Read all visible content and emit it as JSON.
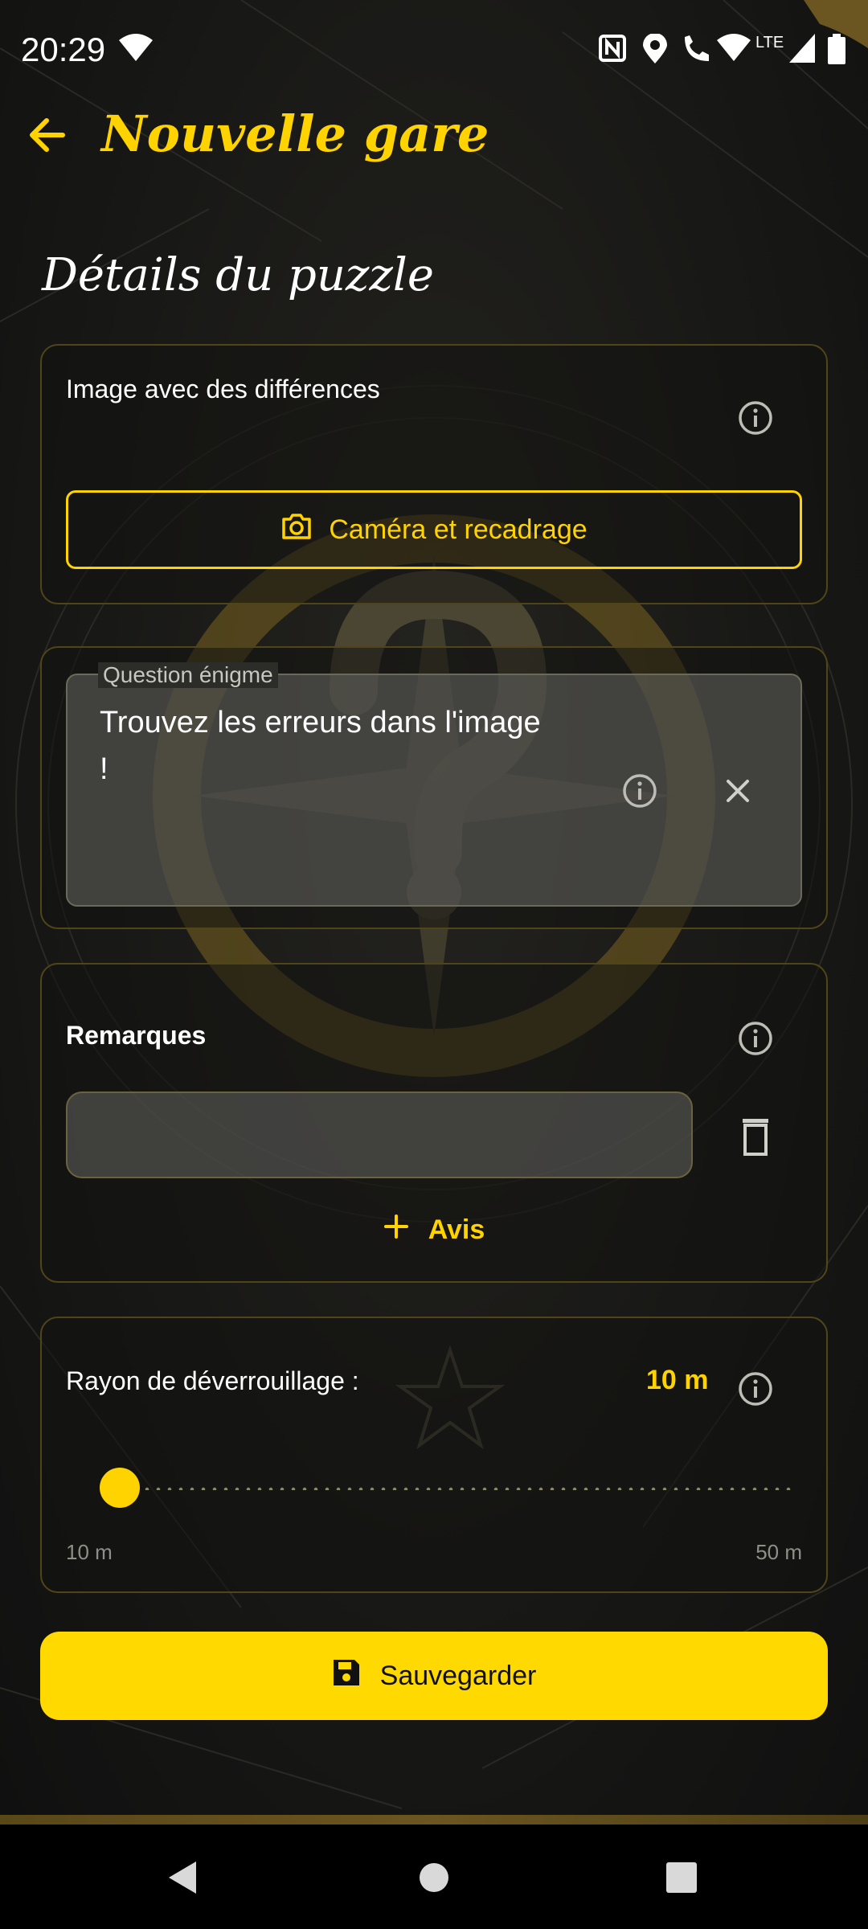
{
  "status_bar": {
    "time": "20:29",
    "network": "LTE",
    "icons": [
      "wifi-icon",
      "nfc-icon",
      "location-icon",
      "wifi-calling-icon",
      "wifi-icon",
      "signal-icon",
      "battery-icon"
    ]
  },
  "app_bar": {
    "title": "Nouvelle gare",
    "back_icon": "arrow-left-icon"
  },
  "section": {
    "title": "Détails du puzzle"
  },
  "image_card": {
    "label": "Image avec des différences",
    "info_icon": "info-icon",
    "camera_button": "Caméra et recadrage",
    "camera_icon": "camera-icon"
  },
  "question_card": {
    "field_label": "Question énigme",
    "field_value": "Trouvez les erreurs dans l'image\n!",
    "info_icon": "info-icon",
    "clear_icon": "close-icon"
  },
  "remarks_card": {
    "label": "Remarques",
    "input_value": "",
    "delete_icon": "trash-icon",
    "add_button": "Avis",
    "add_icon": "plus-icon"
  },
  "radius_card": {
    "label": "Rayon de déverrouillage :",
    "value": "10 m",
    "min_label": "10 m",
    "max_label": "50 m",
    "slider_fraction": 0.0
  },
  "save_button": {
    "label": "Sauvegarder",
    "icon": "save-icon"
  },
  "colors": {
    "accent": "#ffd300",
    "background": "#141413",
    "card_border": "#4f4519"
  },
  "nav_bar": {
    "icons": [
      "back-triangle-icon",
      "home-circle-icon",
      "recents-square-icon"
    ]
  }
}
